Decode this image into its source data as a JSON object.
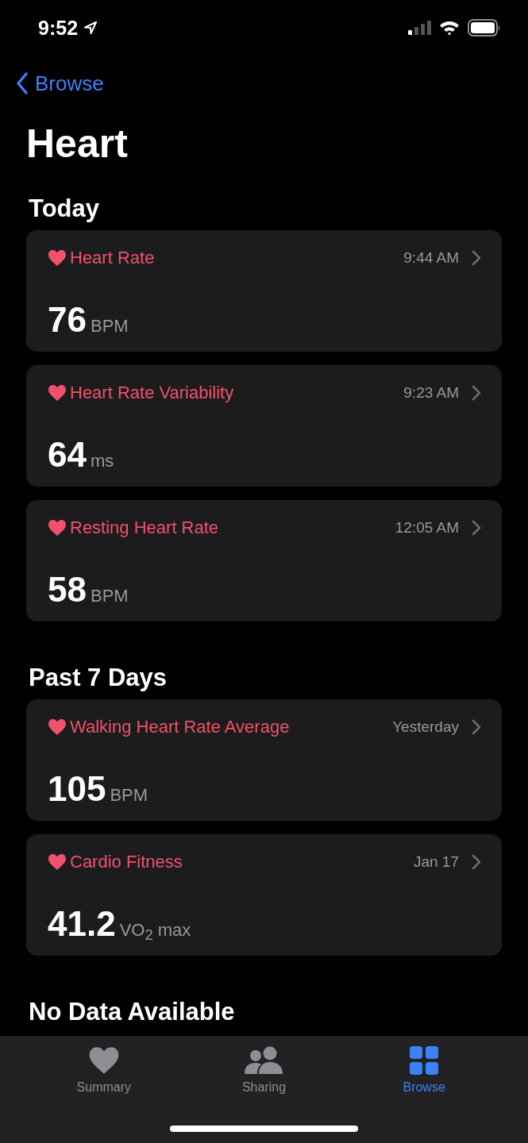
{
  "status_bar": {
    "time": "9:52"
  },
  "nav": {
    "back_label": "Browse"
  },
  "title": "Heart",
  "sections": [
    {
      "title": "Today",
      "cards": [
        {
          "title": "Heart Rate",
          "time": "9:44 AM",
          "value": "76",
          "unit": "BPM"
        },
        {
          "title": "Heart Rate Variability",
          "time": "9:23 AM",
          "value": "64",
          "unit": "ms"
        },
        {
          "title": "Resting Heart Rate",
          "time": "12:05 AM",
          "value": "58",
          "unit": "BPM"
        }
      ]
    },
    {
      "title": "Past 7 Days",
      "cards": [
        {
          "title": "Walking Heart Rate Average",
          "time": "Yesterday",
          "value": "105",
          "unit": "BPM"
        },
        {
          "title": "Cardio Fitness",
          "time": "Jan 17",
          "value": "41.2",
          "unit": "VO$_{2}$ max"
        }
      ]
    },
    {
      "title": "No Data Available"
    }
  ],
  "tab_bar": [
    {
      "label": "Summary",
      "kind": "heart",
      "selected": false
    },
    {
      "label": "Sharing",
      "kind": "people",
      "selected": false
    },
    {
      "label": "Browse",
      "kind": "grid",
      "selected": true
    }
  ]
}
